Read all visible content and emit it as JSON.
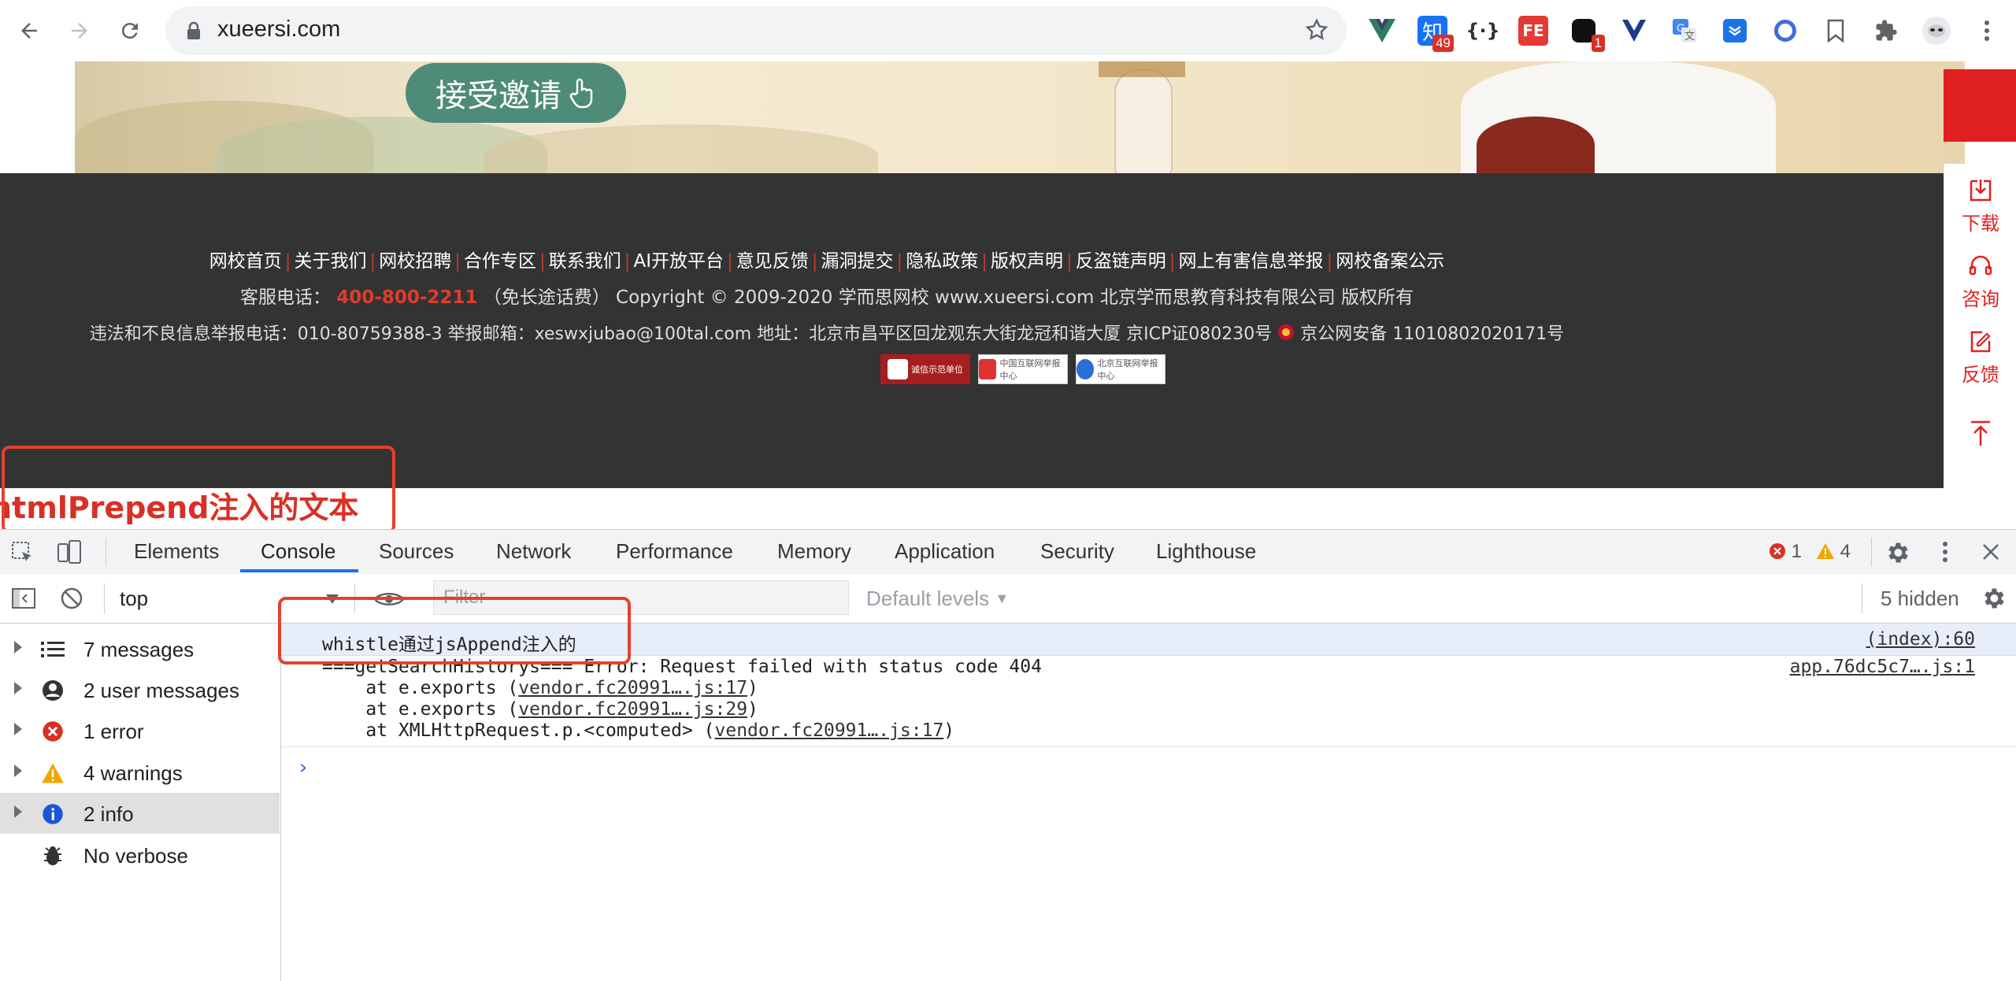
{
  "browser": {
    "url": "xueersi.com",
    "extensions": [
      {
        "name": "vue-devtools-icon"
      },
      {
        "name": "zhihu-icon",
        "label": "知",
        "badge": "49"
      },
      {
        "name": "json-icon",
        "label": "{·}"
      },
      {
        "name": "fe-icon",
        "label": "FE"
      },
      {
        "name": "extension-dark-icon",
        "badge": "1"
      },
      {
        "name": "vue-alt-icon"
      },
      {
        "name": "translate-icon"
      },
      {
        "name": "save-icon"
      },
      {
        "name": "circle-icon"
      },
      {
        "name": "bookmark-icon"
      },
      {
        "name": "puzzle-icon"
      },
      {
        "name": "profile-avatar"
      }
    ]
  },
  "page": {
    "invite_button": "接受邀请",
    "footer": {
      "links": [
        "网校首页",
        "关于我们",
        "网校招聘",
        "合作专区",
        "联系我们",
        "AI开放平台",
        "意见反馈",
        "漏洞提交",
        "隐私政策",
        "版权声明",
        "反盗链声明",
        "网上有害信息举报",
        "网校备案公示"
      ],
      "service_label": "客服电话：",
      "service_tel": "400-800-2211",
      "service_rest": "（免长途话费）  Copyright © 2009-2020 学而思网校 www.xueersi.com 北京学而思教育科技有限公司 版权所有",
      "report_line": "违法和不良信息举报电话：010-80759388-3 举报邮箱：xeswxjubao@100tal.com 地址：北京市昌平区回龙观东大街龙冠和谐大厦 京ICP证080230号",
      "police_line": "京公网安备 11010802020171号",
      "certs": [
        "诚信示范单位",
        "中国互联网举报中心",
        "北京互联网举报中心"
      ]
    },
    "side_panel": [
      "下载",
      "咨询",
      "反馈"
    ],
    "injected_text": "htmlPrepend注入的文本"
  },
  "devtools": {
    "tabs": [
      "Elements",
      "Console",
      "Sources",
      "Network",
      "Performance",
      "Memory",
      "Application",
      "Security",
      "Lighthouse"
    ],
    "active_tab": "Console",
    "error_count": "1",
    "warning_count": "4",
    "context": "top",
    "filter_placeholder": "Filter",
    "levels": "Default levels",
    "hidden": "5 hidden",
    "sidebar": [
      {
        "label": "7 messages",
        "icon": "list-icon"
      },
      {
        "label": "2 user messages",
        "icon": "user-icon"
      },
      {
        "label": "1 error",
        "icon": "error-icon"
      },
      {
        "label": "4 warnings",
        "icon": "warning-icon"
      },
      {
        "label": "2 info",
        "icon": "info-icon"
      },
      {
        "label": "No verbose",
        "icon": "bug-icon"
      }
    ],
    "messages": {
      "m1_text": "whistle通过jsAppend注入的",
      "m1_source": "(index):60",
      "m2_line1": "===getSearchHistorys=== Error: Request failed with status code 404",
      "m2_source": "app.76dc5c7….js:1",
      "m2_l2_prefix": "    at e.exports (",
      "m2_l2_link": "vendor.fc20991….js:17",
      "m2_l3_prefix": "    at e.exports (",
      "m2_l3_link": "vendor.fc20991….js:29",
      "m2_l4_prefix": "    at XMLHttpRequest.p.<computed> (",
      "m2_l4_link": "vendor.fc20991….js:17",
      "close_paren": ")"
    },
    "prompt": "›"
  },
  "colors": {
    "accent": "#1a73e8",
    "error": "#d93025",
    "warning": "#f2a600",
    "footer_bg": "#333333",
    "injected_red": "#d93025"
  }
}
